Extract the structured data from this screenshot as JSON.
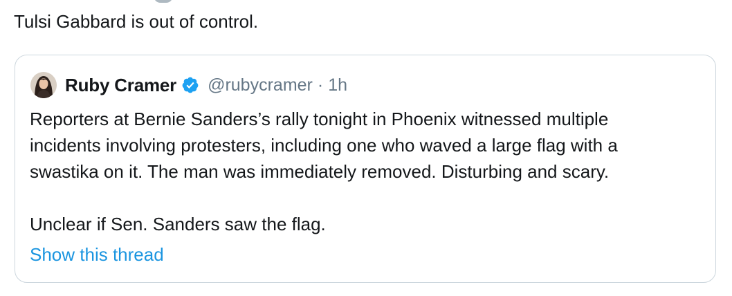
{
  "tweet": {
    "text": "Tulsi Gabbard is out of control."
  },
  "quoted_tweet": {
    "author": {
      "display_name": "Ruby Cramer",
      "verified_icon": "verified-badge-icon",
      "handle": "@rubycramer"
    },
    "separator": "·",
    "timestamp": "1h",
    "body": {
      "paragraph_1": "Reporters at Bernie Sanders’s rally tonight in Phoenix witnessed multiple\nincidents involving protesters, including one who waved a large flag with a\nswastika on it. The man was immediately removed. Disturbing and scary.",
      "paragraph_2": "Unclear if Sen. Sanders saw the flag."
    },
    "show_thread_label": "Show this thread"
  },
  "colors": {
    "text_primary": "#14171a",
    "text_secondary": "#657786",
    "link": "#1b95e0",
    "verified": "#1da1f2",
    "card_border": "#ccd6dd"
  }
}
